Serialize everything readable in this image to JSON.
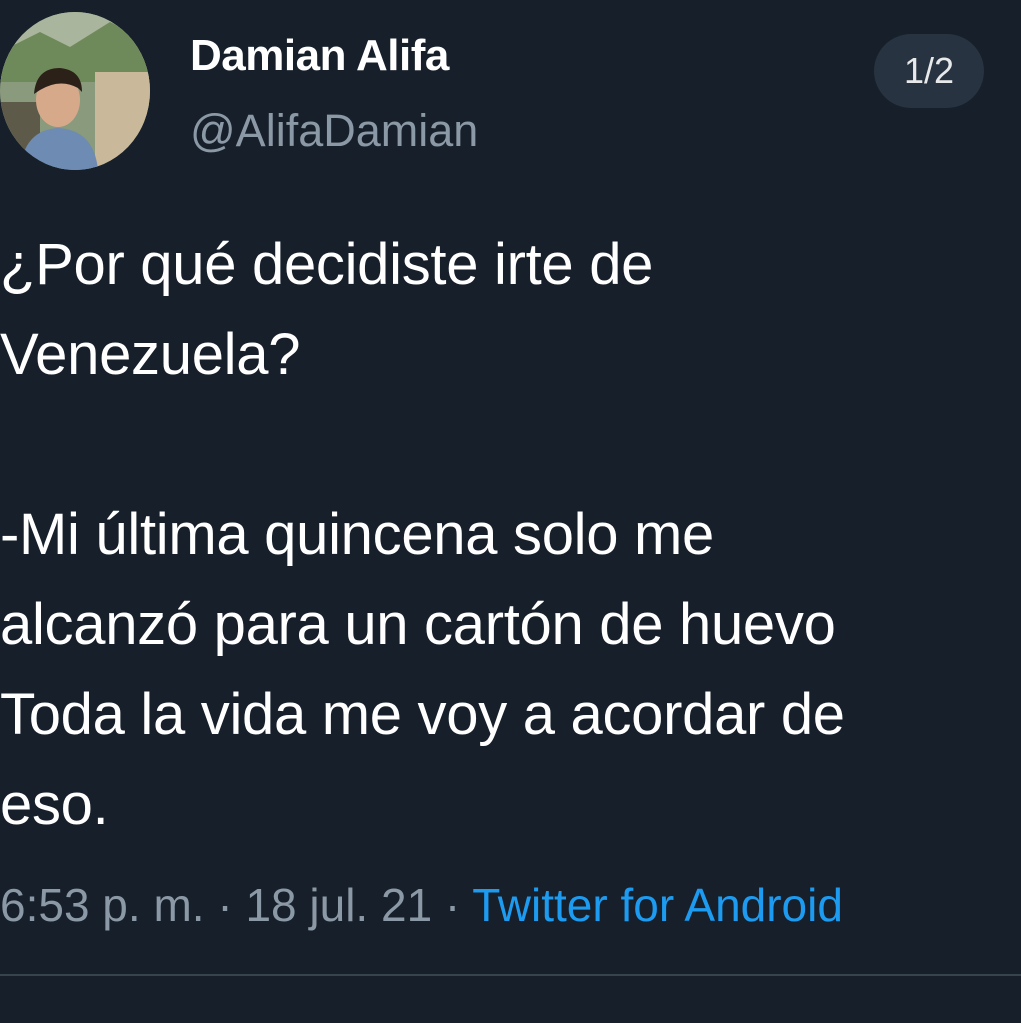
{
  "author": {
    "display_name": "Damian Alifa",
    "handle": "@AlifaDamian"
  },
  "thread_indicator": "1/2",
  "tweet": {
    "lines": [
      "¿Por qué decidiste irte de",
      "Venezuela?",
      "",
      "-Mi última quincena solo me",
      "alcanzó para un cartón de huevo",
      "Toda la vida me voy a acordar de",
      "eso."
    ]
  },
  "meta": {
    "time": "6:53 p. m.",
    "separator": " · ",
    "date": "18 jul. 21",
    "source": "Twitter for Android"
  },
  "colors": {
    "background": "#161f2a",
    "text": "#ffffff",
    "secondary_text": "#8b98a5",
    "link": "#1d9bf0"
  }
}
